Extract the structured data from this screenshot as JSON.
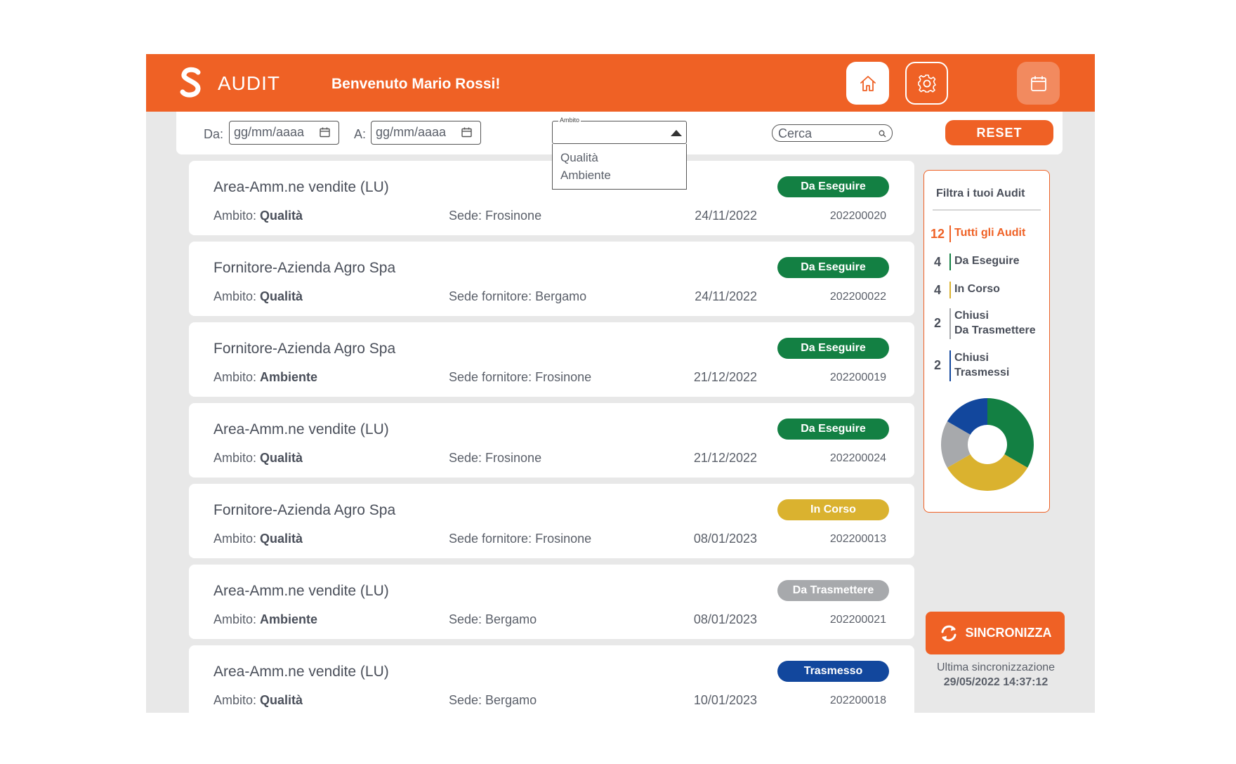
{
  "header": {
    "app_name": "AUDIT",
    "welcome": "Benvenuto Mario Rossi!",
    "icons": [
      "home-icon",
      "gear-icon",
      "calendar-icon"
    ],
    "accent_color": "#ef6125"
  },
  "filters": {
    "from_label": "Da:",
    "from_placeholder": "gg/mm/aaaa",
    "to_label": "A:",
    "to_placeholder": "gg/mm/aaaa",
    "ambito_legend": "Ambito",
    "ambito_options": [
      "Qualità",
      "Ambiente"
    ],
    "search_placeholder": "Cerca",
    "reset_label": "RESET"
  },
  "audits": [
    {
      "title": "Area-Amm.ne vendite (LU)",
      "ambito_label": "Ambito:",
      "ambito": "Qualità",
      "sede": "Sede: Frosinone",
      "date": "24/11/2022",
      "code": "202200020",
      "status": "Da Eseguire",
      "status_color": "#138043"
    },
    {
      "title": "Fornitore-Azienda Agro Spa",
      "ambito_label": "Ambito:",
      "ambito": "Qualità",
      "sede": "Sede fornitore: Bergamo",
      "date": "24/11/2022",
      "code": "202200022",
      "status": "Da Eseguire",
      "status_color": "#138043"
    },
    {
      "title": "Fornitore-Azienda Agro Spa",
      "ambito_label": "Ambito:",
      "ambito": "Ambiente",
      "sede": "Sede fornitore: Frosinone",
      "date": "21/12/2022",
      "code": "202200019",
      "status": "Da Eseguire",
      "status_color": "#138043"
    },
    {
      "title": "Area-Amm.ne vendite (LU)",
      "ambito_label": "Ambito:",
      "ambito": "Qualità",
      "sede": "Sede: Frosinone",
      "date": "21/12/2022",
      "code": "202200024",
      "status": "Da Eseguire",
      "status_color": "#138043"
    },
    {
      "title": "Fornitore-Azienda Agro Spa",
      "ambito_label": "Ambito:",
      "ambito": "Qualità",
      "sede": "Sede fornitore: Frosinone",
      "date": "08/01/2023",
      "code": "202200013",
      "status": "In Corso",
      "status_color": "#dab22f"
    },
    {
      "title": "Area-Amm.ne vendite (LU)",
      "ambito_label": "Ambito:",
      "ambito": "Ambiente",
      "sede": "Sede: Bergamo",
      "date": "08/01/2023",
      "code": "202200021",
      "status": "Da Trasmettere",
      "status_color": "#a7a9ac"
    },
    {
      "title": "Area-Amm.ne vendite (LU)",
      "ambito_label": "Ambito:",
      "ambito": "Qualità",
      "sede": "Sede: Bergamo",
      "date": "10/01/2023",
      "code": "202200018",
      "status": "Trasmesso",
      "status_color": "#12479d"
    }
  ],
  "side_filter": {
    "title": "Filtra i tuoi Audit",
    "items": [
      {
        "count": "12",
        "label_1": "Tutti gli Audit",
        "label_2": "",
        "color": "#ef6125",
        "active": true
      },
      {
        "count": "4",
        "label_1": "Da Eseguire",
        "label_2": "",
        "color": "#138043",
        "active": false
      },
      {
        "count": "4",
        "label_1": "In Corso",
        "label_2": "",
        "color": "#dab22f",
        "active": false
      },
      {
        "count": "2",
        "label_1": "Chiusi",
        "label_2": "Da Trasmettere",
        "color": "#a7a9ac",
        "active": false
      },
      {
        "count": "2",
        "label_1": "Chiusi",
        "label_2": "Trasmessi",
        "color": "#12479d",
        "active": false
      }
    ],
    "donut": [
      {
        "value": 4,
        "color": "#138043"
      },
      {
        "value": 4,
        "color": "#dab22f"
      },
      {
        "value": 2,
        "color": "#a7a9ac"
      },
      {
        "value": 2,
        "color": "#12479d"
      }
    ]
  },
  "sync": {
    "button_label": "SINCRONIZZA",
    "last_label": "Ultima sincronizzazione",
    "last_value": "29/05/2022  14:37:12"
  }
}
